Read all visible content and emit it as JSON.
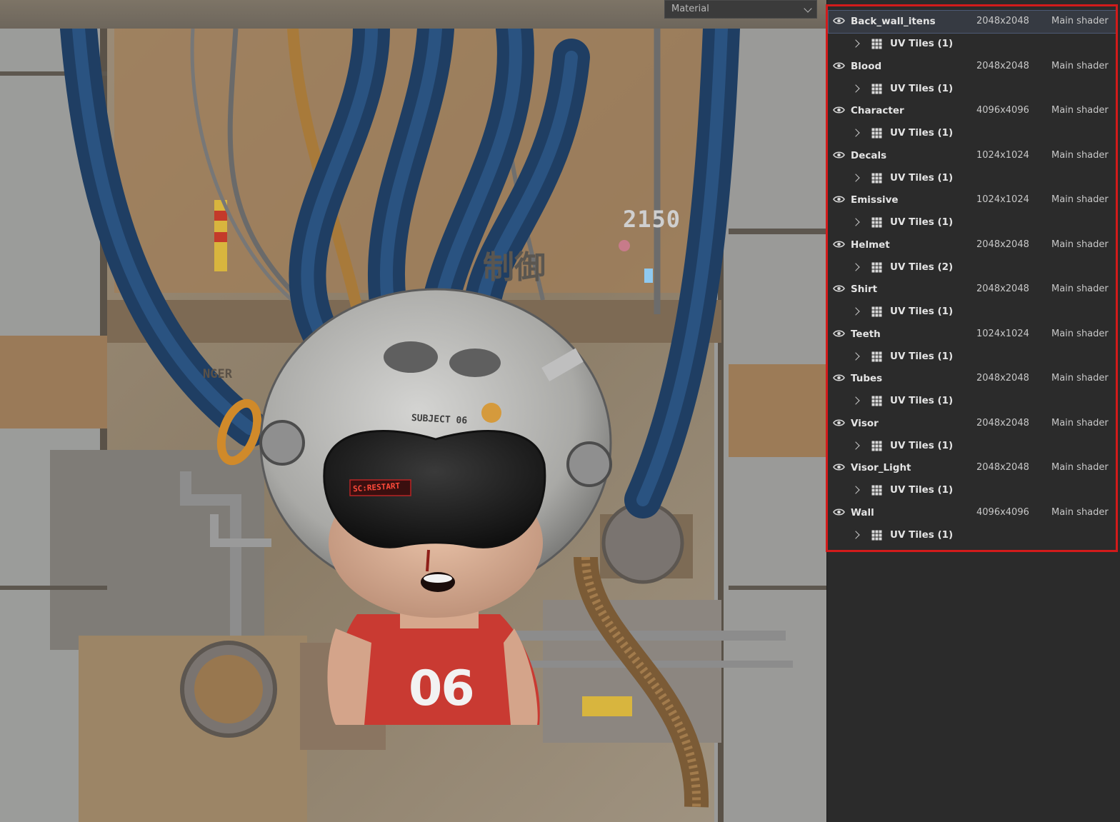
{
  "toolbar": {
    "material_dropdown": {
      "value": "Material",
      "icon": "chevron-down-icon"
    }
  },
  "viewport": {
    "helmet_label": "SUBJECT 06",
    "shirt_number": "06",
    "wall_number": "2150",
    "wall_kanji": "制御",
    "danger_sign": "NGER",
    "visor_display": "SC:RESTART"
  },
  "texture_sets": [
    {
      "name": "Back_wall_itens",
      "resolution": "2048x2048",
      "shader": "Main shader",
      "uv_tiles": "UV Tiles (1)",
      "visible": true,
      "selected": true
    },
    {
      "name": "Blood",
      "resolution": "2048x2048",
      "shader": "Main shader",
      "uv_tiles": "UV Tiles (1)",
      "visible": true
    },
    {
      "name": "Character",
      "resolution": "4096x4096",
      "shader": "Main shader",
      "uv_tiles": "UV Tiles (1)",
      "visible": true
    },
    {
      "name": "Decals",
      "resolution": "1024x1024",
      "shader": "Main shader",
      "uv_tiles": "UV Tiles (1)",
      "visible": true
    },
    {
      "name": "Emissive",
      "resolution": "1024x1024",
      "shader": "Main shader",
      "uv_tiles": "UV Tiles (1)",
      "visible": true
    },
    {
      "name": "Helmet",
      "resolution": "2048x2048",
      "shader": "Main shader",
      "uv_tiles": "UV Tiles (2)",
      "visible": true
    },
    {
      "name": "Shirt",
      "resolution": "2048x2048",
      "shader": "Main shader",
      "uv_tiles": "UV Tiles (1)",
      "visible": true
    },
    {
      "name": "Teeth",
      "resolution": "1024x1024",
      "shader": "Main shader",
      "uv_tiles": "UV Tiles (1)",
      "visible": true
    },
    {
      "name": "Tubes",
      "resolution": "2048x2048",
      "shader": "Main shader",
      "uv_tiles": "UV Tiles (1)",
      "visible": true
    },
    {
      "name": "Visor",
      "resolution": "2048x2048",
      "shader": "Main shader",
      "uv_tiles": "UV Tiles (1)",
      "visible": true
    },
    {
      "name": "Visor_Light",
      "resolution": "2048x2048",
      "shader": "Main shader",
      "uv_tiles": "UV Tiles (1)",
      "visible": true
    },
    {
      "name": "Wall",
      "resolution": "4096x4096",
      "shader": "Main shader",
      "uv_tiles": "UV Tiles (1)",
      "visible": true
    }
  ],
  "colors": {
    "panel_bg": "#2b2b2b",
    "highlight_border": "#d21b1b",
    "selected_row": "#363a42",
    "text": "#e4e4e4"
  }
}
